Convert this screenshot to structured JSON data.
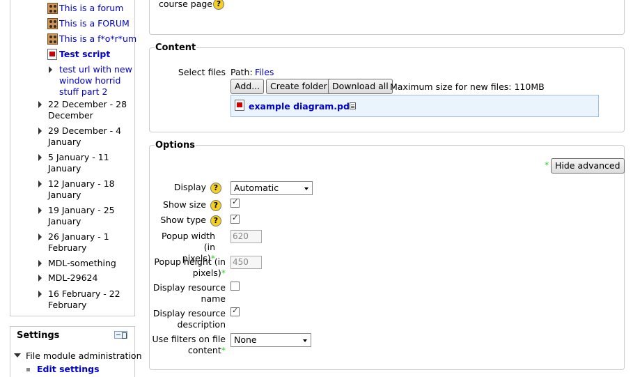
{
  "sidebar": {
    "items": [
      {
        "label": "This is a forum",
        "type": "forum",
        "link": true
      },
      {
        "label": "This is a FORUM",
        "type": "forum",
        "link": true
      },
      {
        "label": "This is a f*o*r*um",
        "type": "forum",
        "link": true
      },
      {
        "label": "Test script",
        "type": "pdf",
        "link": true,
        "bold": true
      },
      {
        "label_lines": [
          "test url with new",
          "window horrid",
          "stuff part 2"
        ],
        "type": "folder",
        "link": true
      }
    ],
    "weeks": [
      {
        "lines": [
          "22 December - 28",
          "December"
        ]
      },
      {
        "lines": [
          "29 December - 4",
          "January"
        ]
      },
      {
        "lines": [
          "5 January - 11",
          "January"
        ]
      },
      {
        "lines": [
          "12 January - 18",
          "January"
        ]
      },
      {
        "lines": [
          "19 January - 25",
          "January"
        ]
      },
      {
        "lines": [
          "26 January - 1",
          "February"
        ]
      },
      {
        "lines": [
          "MDL-something"
        ]
      },
      {
        "lines": [
          "MDL-29624"
        ]
      },
      {
        "lines": [
          "16 February - 22",
          "February"
        ]
      }
    ]
  },
  "settings": {
    "title": "Settings",
    "admin_label": "File module administration",
    "edit_label": "Edit settings"
  },
  "top_fieldset": {
    "partial_label": "course page"
  },
  "content": {
    "legend": "Content",
    "select_files_label": "Select files",
    "path_label": "Path:",
    "path_link": "Files",
    "add_button": "Add...",
    "create_folder_button": "Create folder",
    "download_all_button": "Download all",
    "max_size_text": "Maximum size for new files: 110MB",
    "file_name": "example diagram.pdf"
  },
  "options": {
    "legend": "Options",
    "hide_advanced_button": "Hide advanced",
    "display_label": "Display",
    "display_value": "Automatic",
    "show_size_label": "Show size",
    "show_size_checked": true,
    "show_type_label": "Show type",
    "show_type_checked": true,
    "popup_width_label": [
      "Popup width (in",
      "pixels)"
    ],
    "popup_width_value": "620",
    "popup_height_label": [
      "Popup height (in",
      "pixels)"
    ],
    "popup_height_value": "450",
    "display_resource_name_label": [
      "Display resource",
      "name"
    ],
    "display_resource_name_checked": false,
    "display_resource_description_label": [
      "Display resource",
      "description"
    ],
    "display_resource_description_checked": true,
    "use_filters_label": [
      "Use filters on file",
      "content"
    ],
    "use_filters_value": "None",
    "help_glyph": "?",
    "advanced_marker": "*"
  }
}
